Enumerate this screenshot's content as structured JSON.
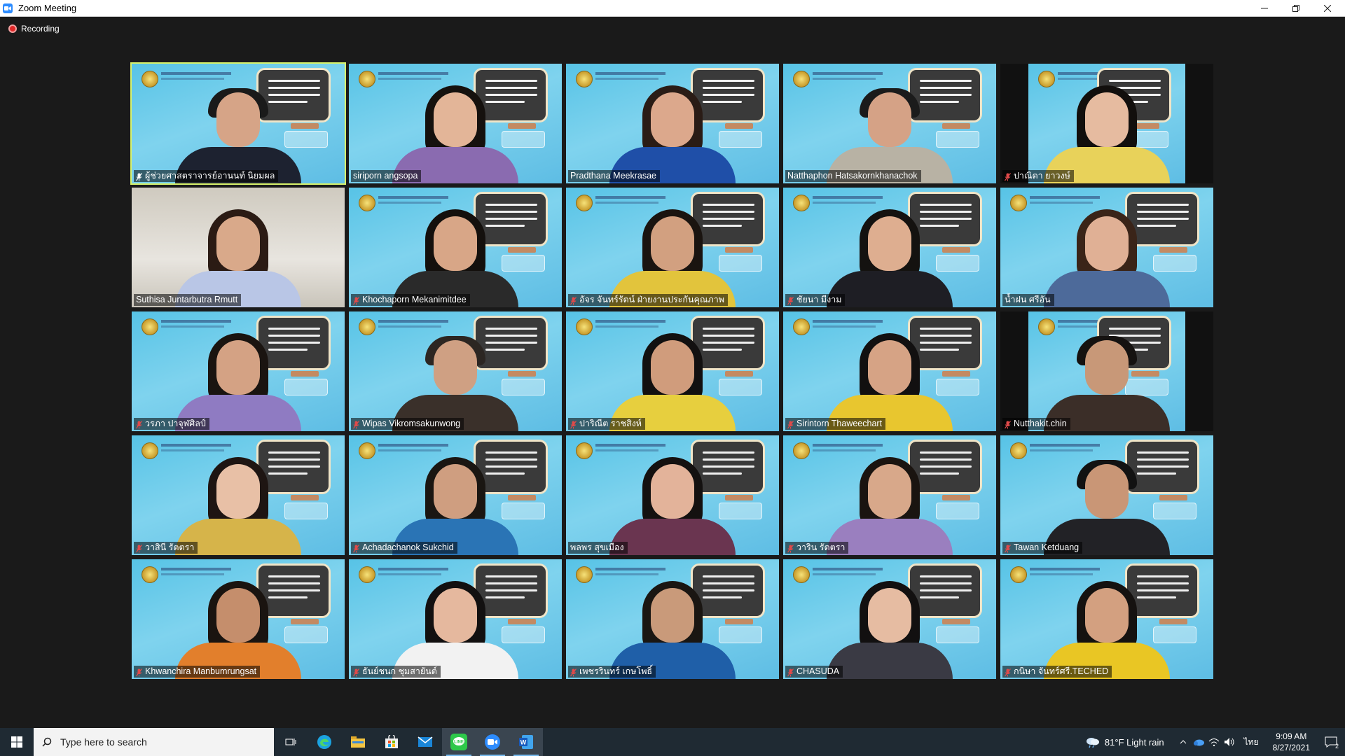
{
  "window": {
    "title": "Zoom Meeting"
  },
  "recording": {
    "label": "Recording"
  },
  "participants": [
    "ผู้ช่วยศาสตราจารย์อานนท์ นิยมผล",
    "siriporn angsopa",
    "Pradthana Meekrasae",
    "Natthaphon Hatsakornkhanachok",
    "ปาณิตา ยาวงษ์",
    "Suthisa  Juntarbutra Rmutt",
    "Khochaporn Mekanimitdee",
    "อัจร จันทร์รัตน์ ฝ่ายงานประกันคุณภาพ",
    "ชัยนา มีงาม",
    "น้ำฝน ศรีอัน",
    "วรภา ปาจุฬศิลป์",
    "Wipas Vikromsakunwong",
    "ปาริณีต ราชสิงห์",
    "Sirintorn Thaweechart",
    "Nutthakit.chin",
    "วาสินี รัตตรา",
    "Achadachanok  Sukchid",
    "พลพร สุขเมือง",
    "วาริน รัตตรา",
    "Tawan Ketduang",
    "Khwanchira Manbumrungsat",
    "ธันย์ชนก ชุมสายันต์",
    "เพชรรินทร์ เกษโพธิ์",
    "CHASUDA",
    "กนิษา จันทร์ศรี.TECHED"
  ],
  "taskbar": {
    "search_placeholder": "Type here to search",
    "weather": "81°F  Light rain",
    "language": "ไทย",
    "time": "9:09 AM",
    "date": "8/27/2021",
    "notification_count": "2",
    "apps": [
      "task-view-icon",
      "edge-icon",
      "file-explorer-icon",
      "store-icon",
      "mail-icon",
      "line-icon",
      "zoom-icon",
      "word-icon"
    ]
  },
  "colors": {
    "active_speaker_border": "#d8f26a",
    "muted_mic": "#e04a4a",
    "background_banner": "#6cc8ea"
  }
}
